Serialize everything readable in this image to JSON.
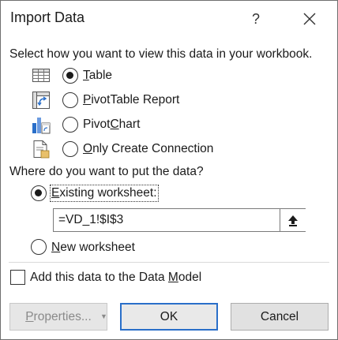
{
  "dialog": {
    "title": "Import Data",
    "help_glyph": "?",
    "view_prompt": "Select how you want to view this data in your workbook.",
    "view_options": [
      {
        "label": "Table",
        "hotkey": "T",
        "checked": true,
        "icon": "table-icon"
      },
      {
        "label": "PivotTable Report",
        "hotkey": "P",
        "checked": false,
        "icon": "pivot-table-icon"
      },
      {
        "label": "PivotChart",
        "hotkey": "C",
        "checked": false,
        "icon": "pivot-chart-icon"
      },
      {
        "label": "Only Create Connection",
        "hotkey": "O",
        "checked": false,
        "icon": "connection-icon"
      }
    ],
    "location_prompt": "Where do you want to put the data?",
    "existing_worksheet_label": "Existing worksheet:",
    "existing_worksheet_checked": true,
    "reference_value": "=VD_1!$I$3",
    "new_worksheet_label": "New worksheet",
    "new_worksheet_checked": false,
    "data_model_label": "Add this data to the Data Model",
    "data_model_checked": false,
    "buttons": {
      "properties": "Properties...",
      "ok": "OK",
      "cancel": "Cancel"
    }
  },
  "colors": {
    "accent": "#2a6fc9",
    "border": "#6f6f6f",
    "button": "#e1e1e1"
  }
}
